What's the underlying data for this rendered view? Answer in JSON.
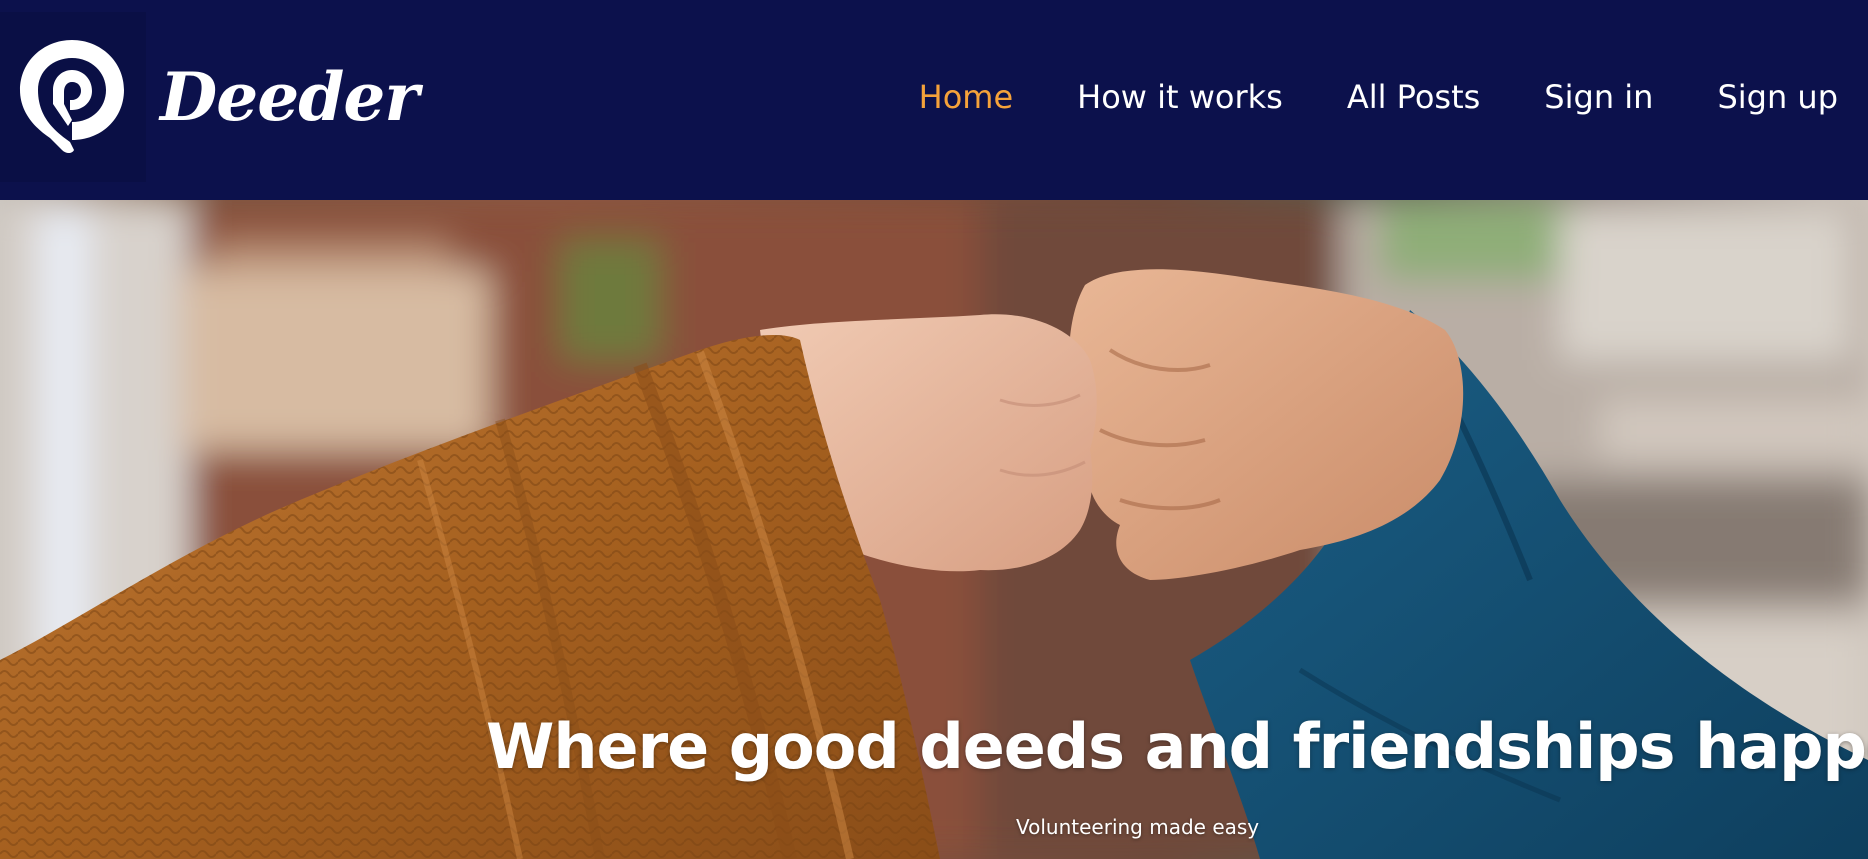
{
  "brand": {
    "name": "Deeder",
    "logo_icon": "location-pin-icon"
  },
  "nav": {
    "items": [
      {
        "label": "Home",
        "active": true
      },
      {
        "label": "How it works",
        "active": false
      },
      {
        "label": "All Posts",
        "active": false
      },
      {
        "label": "Sign in",
        "active": false
      },
      {
        "label": "Sign up",
        "active": false
      }
    ]
  },
  "hero": {
    "title": "Where good deeds and friendships happen",
    "subtitle": "Volunteering made easy",
    "image": "fist-bump-photo"
  },
  "colors": {
    "nav_background": "#0c114c",
    "accent": "#f5a23a",
    "text": "#ffffff"
  }
}
